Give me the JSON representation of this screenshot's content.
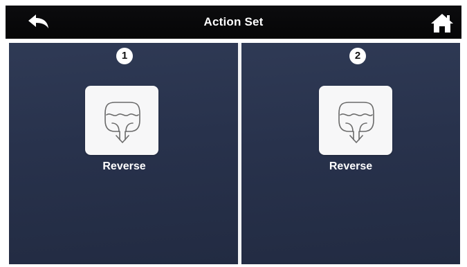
{
  "header": {
    "title": "Action Set",
    "back_icon": "back-arrow-icon",
    "home_icon": "home-icon"
  },
  "panels": [
    {
      "number": "1",
      "icon": "reverse-spray-icon",
      "label": "Reverse"
    },
    {
      "number": "2",
      "icon": "reverse-spray-icon",
      "label": "Reverse"
    }
  ],
  "colors": {
    "header_bg": "#070708",
    "panel_bg": "#28324c",
    "tile_bg": "#f7f7f8",
    "text": "#ffffff"
  }
}
